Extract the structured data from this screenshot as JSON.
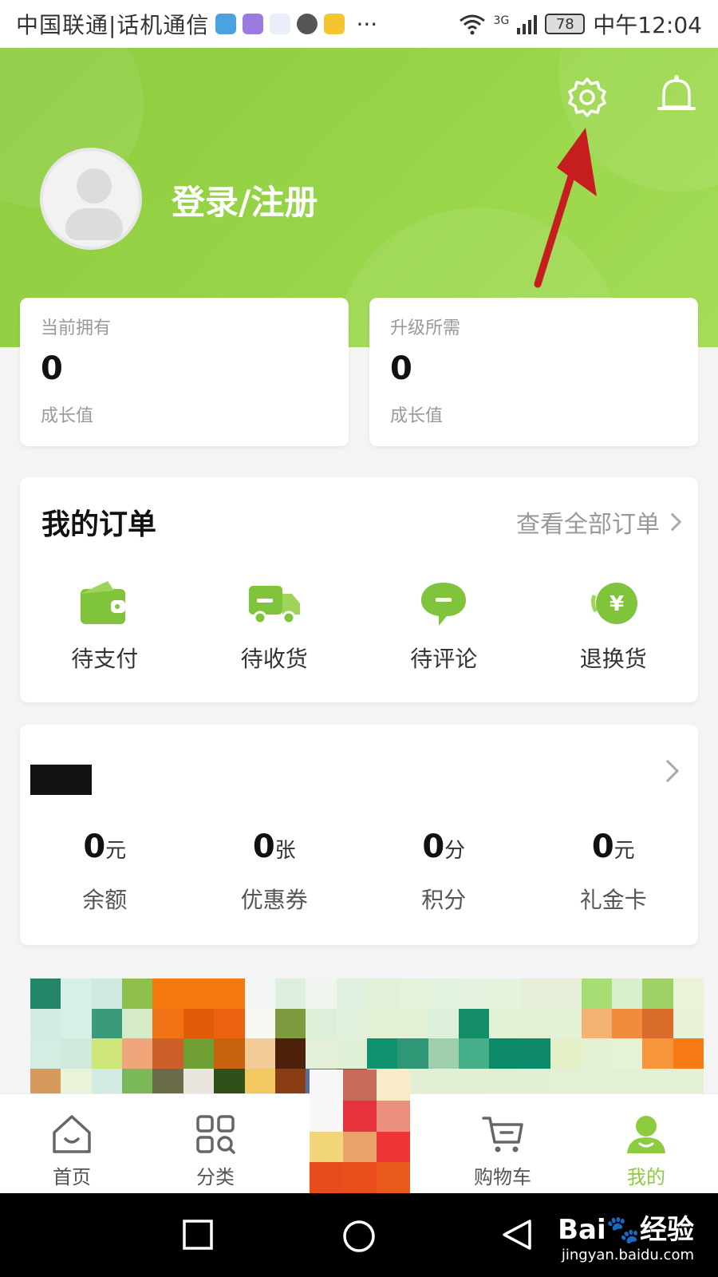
{
  "status_bar": {
    "carrier": "中国联通|话机通信",
    "network": "3G",
    "battery": "78",
    "time": "中午12:04",
    "more": "···"
  },
  "header": {
    "login_label": "登录/注册",
    "accent_color": "#8dcb3f"
  },
  "growth": [
    {
      "label": "当前拥有",
      "value": "0",
      "unit": "成长值"
    },
    {
      "label": "升级所需",
      "value": "0",
      "unit": "成长值"
    }
  ],
  "orders": {
    "title": "我的订单",
    "view_all": "查看全部订单",
    "items": [
      {
        "label": "待支付",
        "icon": "wallet-icon"
      },
      {
        "label": "待收货",
        "icon": "truck-icon"
      },
      {
        "label": "待评论",
        "icon": "comment-icon"
      },
      {
        "label": "退换货",
        "icon": "yuan-refund-icon"
      }
    ]
  },
  "assets": {
    "items": [
      {
        "value": "0",
        "unit": "元",
        "label": "余额"
      },
      {
        "value": "0",
        "unit": "张",
        "label": "优惠券"
      },
      {
        "value": "0",
        "unit": "分",
        "label": "积分"
      },
      {
        "value": "0",
        "unit": "元",
        "label": "礼金卡"
      }
    ]
  },
  "tabbar": {
    "items": [
      {
        "label": "首页",
        "icon": "home-icon"
      },
      {
        "label": "分类",
        "icon": "category-icon"
      },
      {
        "label": "",
        "icon": "center-promo"
      },
      {
        "label": "购物车",
        "icon": "cart-icon"
      },
      {
        "label": "我的",
        "icon": "user-icon",
        "active": true
      }
    ]
  },
  "watermark": {
    "brand": "Bai",
    "brand2": "经验",
    "url": "jingyan.baidu.com"
  }
}
